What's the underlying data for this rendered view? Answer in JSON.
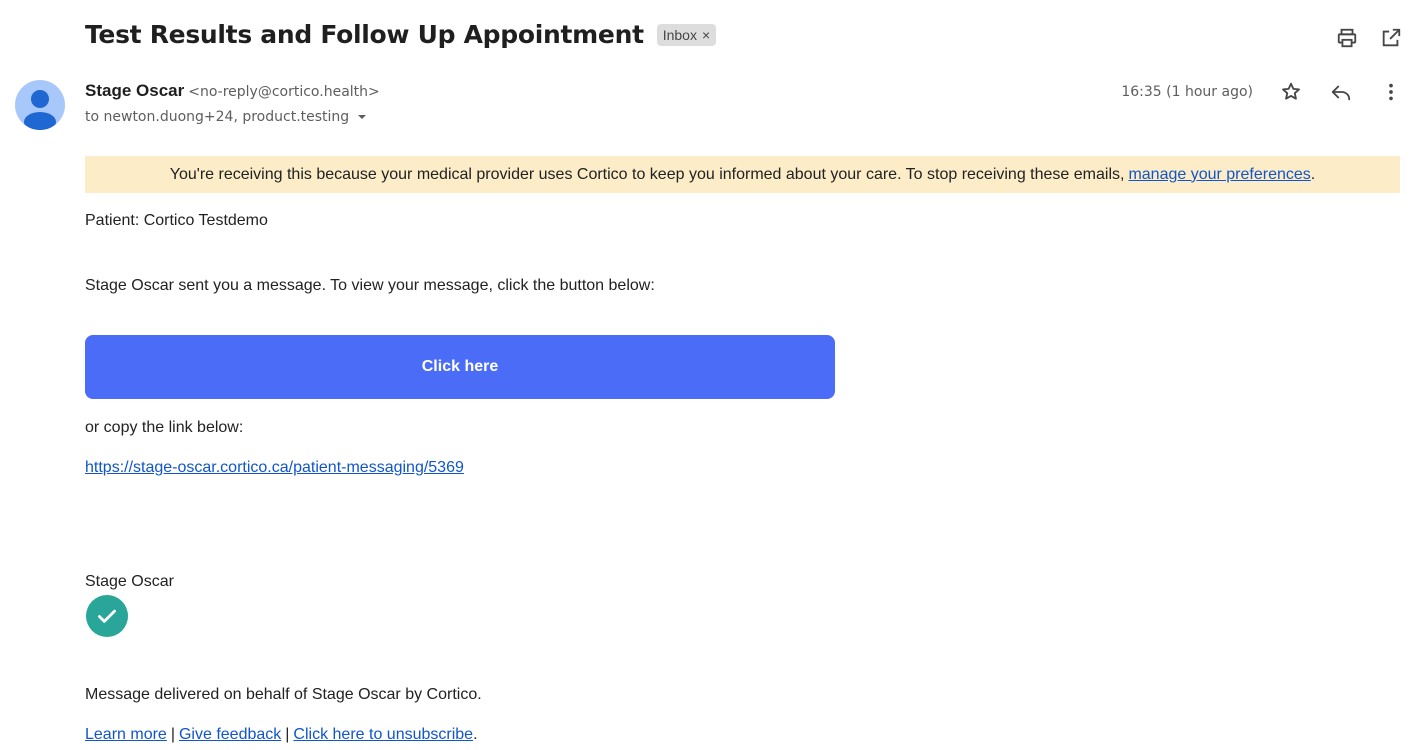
{
  "email": {
    "subject": "Test Results and Follow Up Appointment",
    "label": "Inbox",
    "label_remove": "×",
    "sender_name": "Stage Oscar",
    "sender_email": "<no-reply@cortico.health>",
    "recipients": "to newton.duong+24, product.testing",
    "timestamp": "16:35 (1 hour ago)"
  },
  "icons": {
    "print": "print-icon",
    "open_new_window": "open-in-new-window-icon",
    "star": "star-icon",
    "reply": "reply-icon",
    "more": "more-vertical-icon",
    "expand": "chevron-down-icon",
    "avatar": "person-avatar-icon",
    "logo": "checkmark-logo-icon"
  },
  "banner": {
    "text": "You're receiving this because your medical provider uses Cortico to keep you informed about your care. To stop receiving these emails,",
    "link_text": "manage your preferences",
    "suffix": "."
  },
  "body": {
    "patient": "Patient: Cortico Testdemo",
    "intro": "Stage Oscar sent you a message. To view your message, click the button below:",
    "button_label": "Click here",
    "copy_link_text": "or copy the link below:",
    "url": "https://stage-oscar.cortico.ca/patient-messaging/5369",
    "signature": "Stage Oscar",
    "delivered_note": "Message delivered on behalf of Stage Oscar by Cortico."
  },
  "footer": {
    "learn_more": "Learn more",
    "separator": "|",
    "give_feedback": "Give feedback",
    "unsubscribe": "Click here to unsubscribe",
    "end": "."
  },
  "colors": {
    "banner_bg": "#fcedc8",
    "button_bg": "#4a6cf7",
    "link": "#1155cc",
    "logo": "#2aa59a",
    "avatar": "#a8c7fa"
  }
}
